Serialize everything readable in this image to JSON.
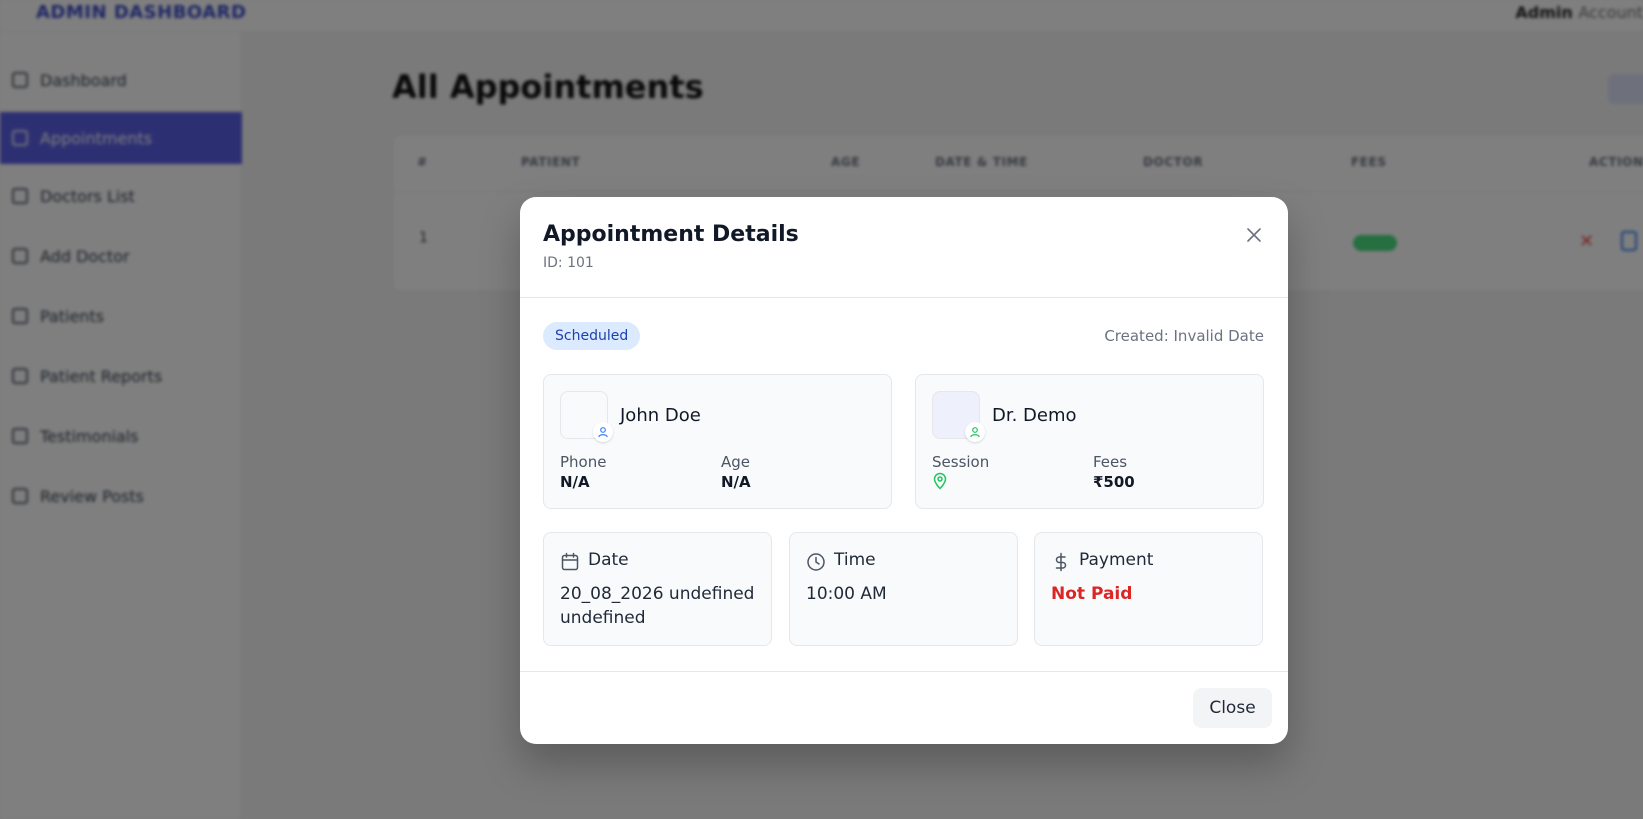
{
  "background": {
    "brand": "ADMIN DASHBOARD",
    "admin_name": "Admin",
    "admin_role": "Account",
    "page_title": "All Appointments",
    "sidebar": {
      "items": [
        {
          "label": "Dashboard",
          "icon": "dashboard-icon",
          "active": false
        },
        {
          "label": "Appointments",
          "icon": "check-icon",
          "active": true
        },
        {
          "label": "Doctors List",
          "icon": "list-icon",
          "active": false
        },
        {
          "label": "Add Doctor",
          "icon": "add-icon",
          "active": false
        },
        {
          "label": "Patients",
          "icon": "users-icon",
          "active": false
        },
        {
          "label": "Patient Reports",
          "icon": "chart-icon",
          "active": false
        },
        {
          "label": "Testimonials",
          "icon": "message-icon",
          "active": false
        },
        {
          "label": "Review Posts",
          "icon": "document-icon",
          "active": false
        }
      ]
    },
    "table": {
      "columns": [
        "#",
        "PATIENT",
        "AGE",
        "DATE & TIME",
        "DOCTOR",
        "FEES",
        "ACTIONS"
      ],
      "first_cell": "1"
    }
  },
  "modal": {
    "title": "Appointment Details",
    "id_text": "ID: 101",
    "status": "Scheduled",
    "created": "Created: Invalid Date",
    "patient": {
      "name": "John Doe",
      "phone_label": "Phone",
      "phone": "N/A",
      "age_label": "Age",
      "age": "N/A"
    },
    "doctor": {
      "name": "Dr. Demo",
      "session_label": "Session",
      "fees_label": "Fees",
      "fees": "₹500"
    },
    "date": {
      "label": "Date",
      "value": "20_08_2026 undefined undefined"
    },
    "time": {
      "label": "Time",
      "value": "10:00 AM"
    },
    "payment": {
      "label": "Payment",
      "value": "Not Paid"
    },
    "close_label": "Close",
    "colors": {
      "status_bg": "#dbeafe",
      "status_text": "#1e40af",
      "not_paid": "#dc2626",
      "doctor_icon": "#22c55e",
      "patient_icon": "#3b82f6"
    }
  }
}
